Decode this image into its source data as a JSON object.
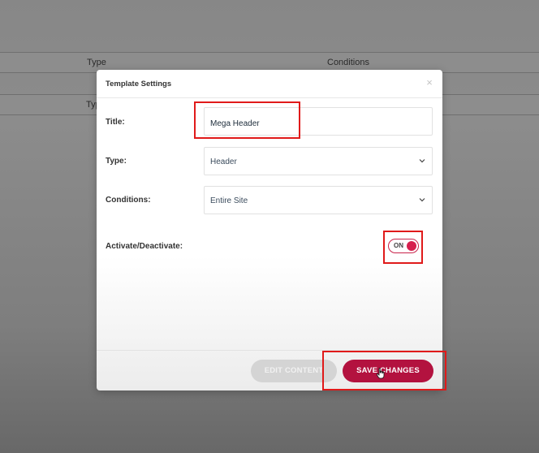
{
  "background": {
    "col_type_1": "Type",
    "col_conditions": "Conditions",
    "col_type_2": "Typ"
  },
  "modal": {
    "title": "Template Settings",
    "close_symbol": "×",
    "fields": {
      "title_label": "Title:",
      "title_value": "Mega Header",
      "type_label": "Type:",
      "type_value": "Header",
      "conditions_label": "Conditions:",
      "conditions_value": "Entire Site",
      "activate_label": "Activate/Deactivate:",
      "toggle_label": "ON"
    },
    "buttons": {
      "edit_content": "EDIT CONTENT",
      "save_changes": "SAVE CHANGES"
    }
  },
  "colors": {
    "accent": "#b3123f",
    "toggle_knob": "#d6204e",
    "annotation": "#e01a1a"
  },
  "icons": [
    "close-icon",
    "chevron-down-icon",
    "hand-cursor-icon"
  ]
}
